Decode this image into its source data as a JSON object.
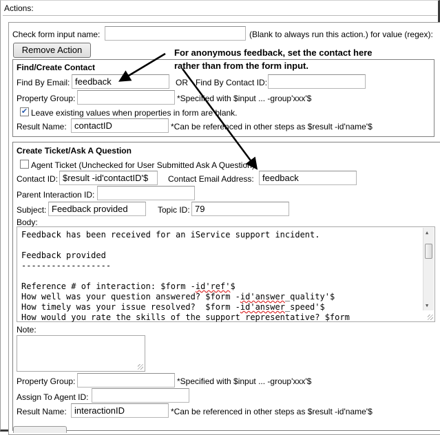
{
  "header": {
    "actions_label": "Actions:"
  },
  "check_form": {
    "label": "Check form input name:",
    "value": "",
    "hint": "(Blank to always run this action.) for value (regex):"
  },
  "remove_action_label": "Remove Action",
  "callout_lines": [
    "For anonymous feedback, set the contact here",
    "rather than from the form input."
  ],
  "find_create": {
    "title": "Find/Create Contact",
    "email_label": "Find By Email:",
    "email_value": "feedback",
    "or_label": "OR",
    "contact_id_label": "Find By Contact ID:",
    "contact_id_value": "",
    "property_group_label": "Property Group:",
    "property_group_value": "",
    "property_group_hint": "*Specified with $input ... -group'xxx'$",
    "leave_existing_label": "Leave existing values when properties in form are blank.",
    "leave_existing_checked": true,
    "result_name_label": "Result Name:",
    "result_name_value": "contactID",
    "result_name_hint": "*Can be referenced in other steps as $result -id'name'$"
  },
  "ticket": {
    "title": "Create Ticket/Ask A Question",
    "agent_ticket_label": "Agent Ticket (Unchecked for User Submitted Ask A Question)",
    "agent_ticket_checked": false,
    "contact_id_label": "Contact ID:",
    "contact_id_value": "$result -id'contactID'$",
    "contact_email_label": "Contact Email Address:",
    "contact_email_value": "feedback",
    "parent_label": "Parent Interaction ID:",
    "parent_value": "",
    "subject_label": "Subject:",
    "subject_value": "Feedback provided",
    "topic_label": "Topic ID:",
    "topic_value": "79",
    "body_label": "Body:",
    "body_lines": [
      "Feedback has been received for an iService support incident.",
      "",
      "Feedback provided",
      "------------------",
      "",
      "Reference # of interaction: $form -id'ref'$",
      "How well was your question answered? $form -id'answer_quality'$",
      "How timely was your issue resolved?  $form -id'answer_speed'$",
      "How would you rate the skills of the support representative? $form"
    ],
    "note_label": "Note:",
    "note_value": "",
    "property_group_label": "Property Group:",
    "property_group_value": "",
    "property_group_hint": "*Specified with $input ... -group'xxx'$",
    "assign_label": "Assign To Agent ID:",
    "assign_value": "",
    "result_name_label": "Result Name:",
    "result_name_value": "interactionID",
    "result_name_hint": "*Can be referenced in other steps as $result -id'name'$"
  }
}
